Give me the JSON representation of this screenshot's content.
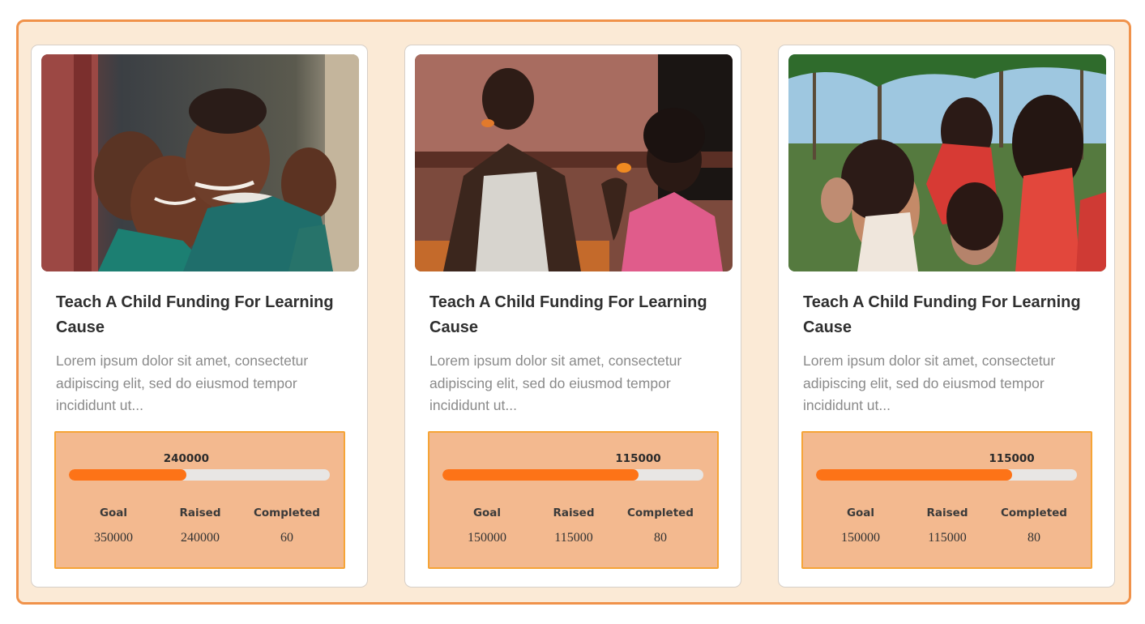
{
  "theme": {
    "frame_bg": "#fbead6",
    "frame_border": "#f0924a",
    "stats_bg": "#f3b98f",
    "stats_border": "#f6a436",
    "progress_fill": "#fd7317",
    "progress_track": "#e8e6e4"
  },
  "cards": [
    {
      "image_alt": "smiling children in green school uniforms",
      "title": "Teach A Child Funding For Learning Cause",
      "description": "Lorem ipsum dolor sit amet, consectetur adipiscing elit, sed do eiusmod tempor incididunt ut...",
      "raised_display": "240000",
      "progress_fraction": 0.45,
      "goal_label": "Goal",
      "raised_label": "Raised",
      "completed_label": "Completed",
      "goal": "350000",
      "raised": "240000",
      "completed": "60"
    },
    {
      "image_alt": "two children eating snacks",
      "title": "Teach A Child Funding For Learning Cause",
      "description": "Lorem ipsum dolor sit amet, consectetur adipiscing elit, sed do eiusmod tempor incididunt ut...",
      "raised_display": "115000",
      "progress_fraction": 0.75,
      "goal_label": "Goal",
      "raised_label": "Raised",
      "completed_label": "Completed",
      "goal": "150000",
      "raised": "115000",
      "completed": "80"
    },
    {
      "image_alt": "group of children outdoors under palm trees",
      "title": "Teach A Child Funding For Learning Cause",
      "description": "Lorem ipsum dolor sit amet, consectetur adipiscing elit, sed do eiusmod tempor incididunt ut...",
      "raised_display": "115000",
      "progress_fraction": 0.75,
      "goal_label": "Goal",
      "raised_label": "Raised",
      "completed_label": "Completed",
      "goal": "150000",
      "raised": "115000",
      "completed": "80"
    }
  ]
}
